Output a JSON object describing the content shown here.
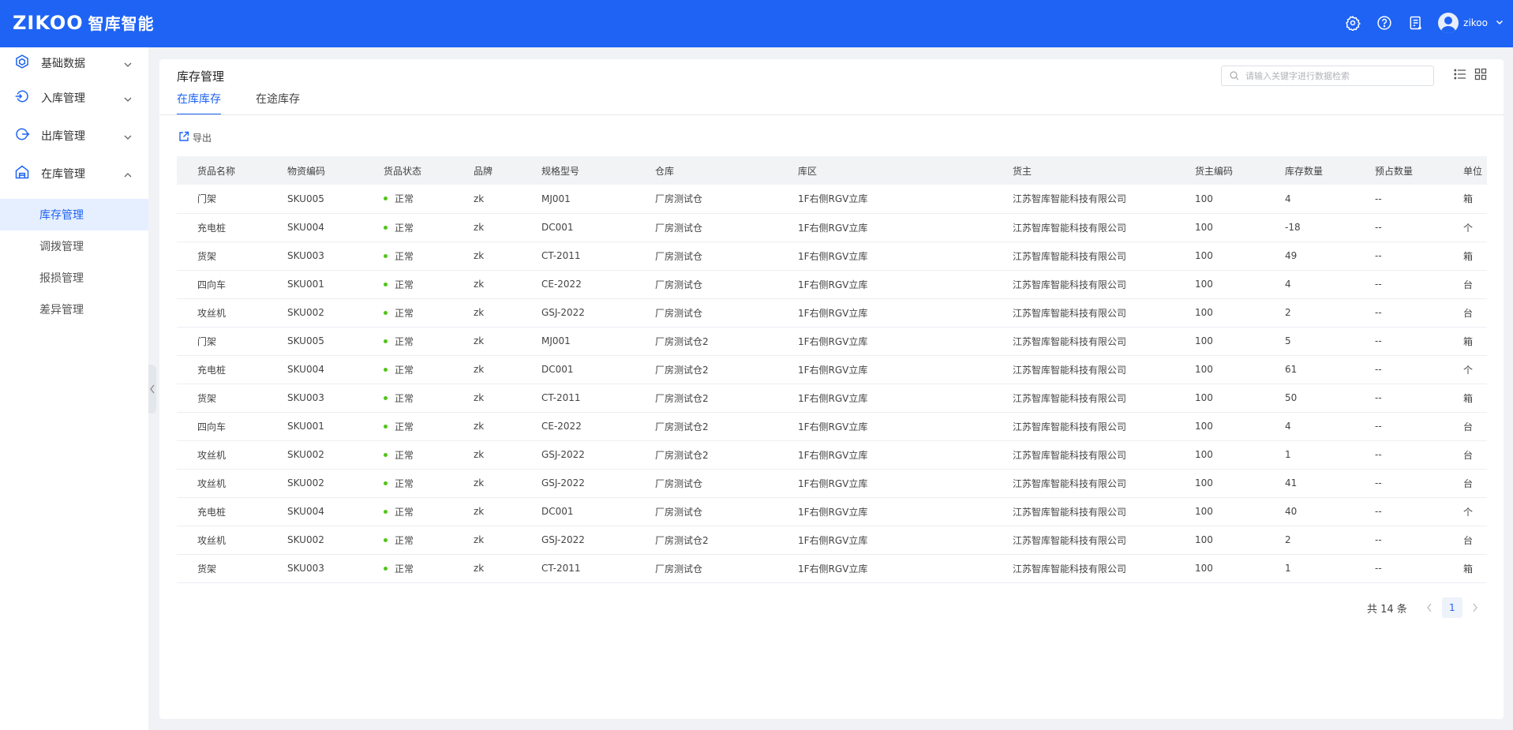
{
  "app": {
    "logo_brand": "ZIKOO",
    "logo_cn": "智库智能",
    "user_name": "zikoo"
  },
  "sidebar": {
    "groups": [
      {
        "label": "基础数据",
        "icon": "cube-icon",
        "expanded": false
      },
      {
        "label": "入库管理",
        "icon": "inbound-icon",
        "expanded": false
      },
      {
        "label": "出库管理",
        "icon": "outbound-icon",
        "expanded": false
      },
      {
        "label": "在库管理",
        "icon": "warehouse-icon",
        "expanded": true
      }
    ],
    "sub_items": [
      {
        "label": "库存管理",
        "active": true
      },
      {
        "label": "调拨管理",
        "active": false
      },
      {
        "label": "报损管理",
        "active": false
      },
      {
        "label": "差异管理",
        "active": false
      }
    ]
  },
  "page": {
    "title": "库存管理",
    "tabs": [
      {
        "label": "在库库存",
        "active": true
      },
      {
        "label": "在途库存",
        "active": false
      }
    ],
    "search_placeholder": "请输入关键字进行数据检索",
    "export_label": "导出"
  },
  "table": {
    "columns": [
      "货品名称",
      "物资编码",
      "货品状态",
      "品牌",
      "规格型号",
      "仓库",
      "库区",
      "货主",
      "货主编码",
      "库存数量",
      "预占数量",
      "单位"
    ],
    "rows": [
      [
        "门架",
        "SKU005",
        "正常",
        "zk",
        "MJ001",
        "厂房测试仓",
        "1F右侧RGV立库",
        "江苏智库智能科技有限公司",
        "100",
        "4",
        "--",
        "箱"
      ],
      [
        "充电桩",
        "SKU004",
        "正常",
        "zk",
        "DC001",
        "厂房测试仓",
        "1F右侧RGV立库",
        "江苏智库智能科技有限公司",
        "100",
        "-18",
        "--",
        "个"
      ],
      [
        "货架",
        "SKU003",
        "正常",
        "zk",
        "CT-2011",
        "厂房测试仓",
        "1F右侧RGV立库",
        "江苏智库智能科技有限公司",
        "100",
        "49",
        "--",
        "箱"
      ],
      [
        "四向车",
        "SKU001",
        "正常",
        "zk",
        "CE-2022",
        "厂房测试仓",
        "1F右侧RGV立库",
        "江苏智库智能科技有限公司",
        "100",
        "4",
        "--",
        "台"
      ],
      [
        "攻丝机",
        "SKU002",
        "正常",
        "zk",
        "GSJ-2022",
        "厂房测试仓",
        "1F右侧RGV立库",
        "江苏智库智能科技有限公司",
        "100",
        "2",
        "--",
        "台"
      ],
      [
        "门架",
        "SKU005",
        "正常",
        "zk",
        "MJ001",
        "厂房测试仓2",
        "1F右侧RGV立库",
        "江苏智库智能科技有限公司",
        "100",
        "5",
        "--",
        "箱"
      ],
      [
        "充电桩",
        "SKU004",
        "正常",
        "zk",
        "DC001",
        "厂房测试仓2",
        "1F右侧RGV立库",
        "江苏智库智能科技有限公司",
        "100",
        "61",
        "--",
        "个"
      ],
      [
        "货架",
        "SKU003",
        "正常",
        "zk",
        "CT-2011",
        "厂房测试仓2",
        "1F右侧RGV立库",
        "江苏智库智能科技有限公司",
        "100",
        "50",
        "--",
        "箱"
      ],
      [
        "四向车",
        "SKU001",
        "正常",
        "zk",
        "CE-2022",
        "厂房测试仓2",
        "1F右侧RGV立库",
        "江苏智库智能科技有限公司",
        "100",
        "4",
        "--",
        "台"
      ],
      [
        "攻丝机",
        "SKU002",
        "正常",
        "zk",
        "GSJ-2022",
        "厂房测试仓2",
        "1F右侧RGV立库",
        "江苏智库智能科技有限公司",
        "100",
        "1",
        "--",
        "台"
      ],
      [
        "攻丝机",
        "SKU002",
        "正常",
        "zk",
        "GSJ-2022",
        "厂房测试仓",
        "1F右侧RGV立库",
        "江苏智库智能科技有限公司",
        "100",
        "41",
        "--",
        "台"
      ],
      [
        "充电桩",
        "SKU004",
        "正常",
        "zk",
        "DC001",
        "厂房测试仓",
        "1F右侧RGV立库",
        "江苏智库智能科技有限公司",
        "100",
        "40",
        "--",
        "个"
      ],
      [
        "攻丝机",
        "SKU002",
        "正常",
        "zk",
        "GSJ-2022",
        "厂房测试仓2",
        "1F右侧RGV立库",
        "江苏智库智能科技有限公司",
        "100",
        "2",
        "--",
        "台"
      ],
      [
        "货架",
        "SKU003",
        "正常",
        "zk",
        "CT-2011",
        "厂房测试仓",
        "1F右侧RGV立库",
        "江苏智库智能科技有限公司",
        "100",
        "1",
        "--",
        "箱"
      ]
    ]
  },
  "pagination": {
    "total_label": "共 14 条",
    "current_page": "1"
  },
  "colors": {
    "primary": "#1e63f4",
    "status_normal": "#52c41a"
  }
}
